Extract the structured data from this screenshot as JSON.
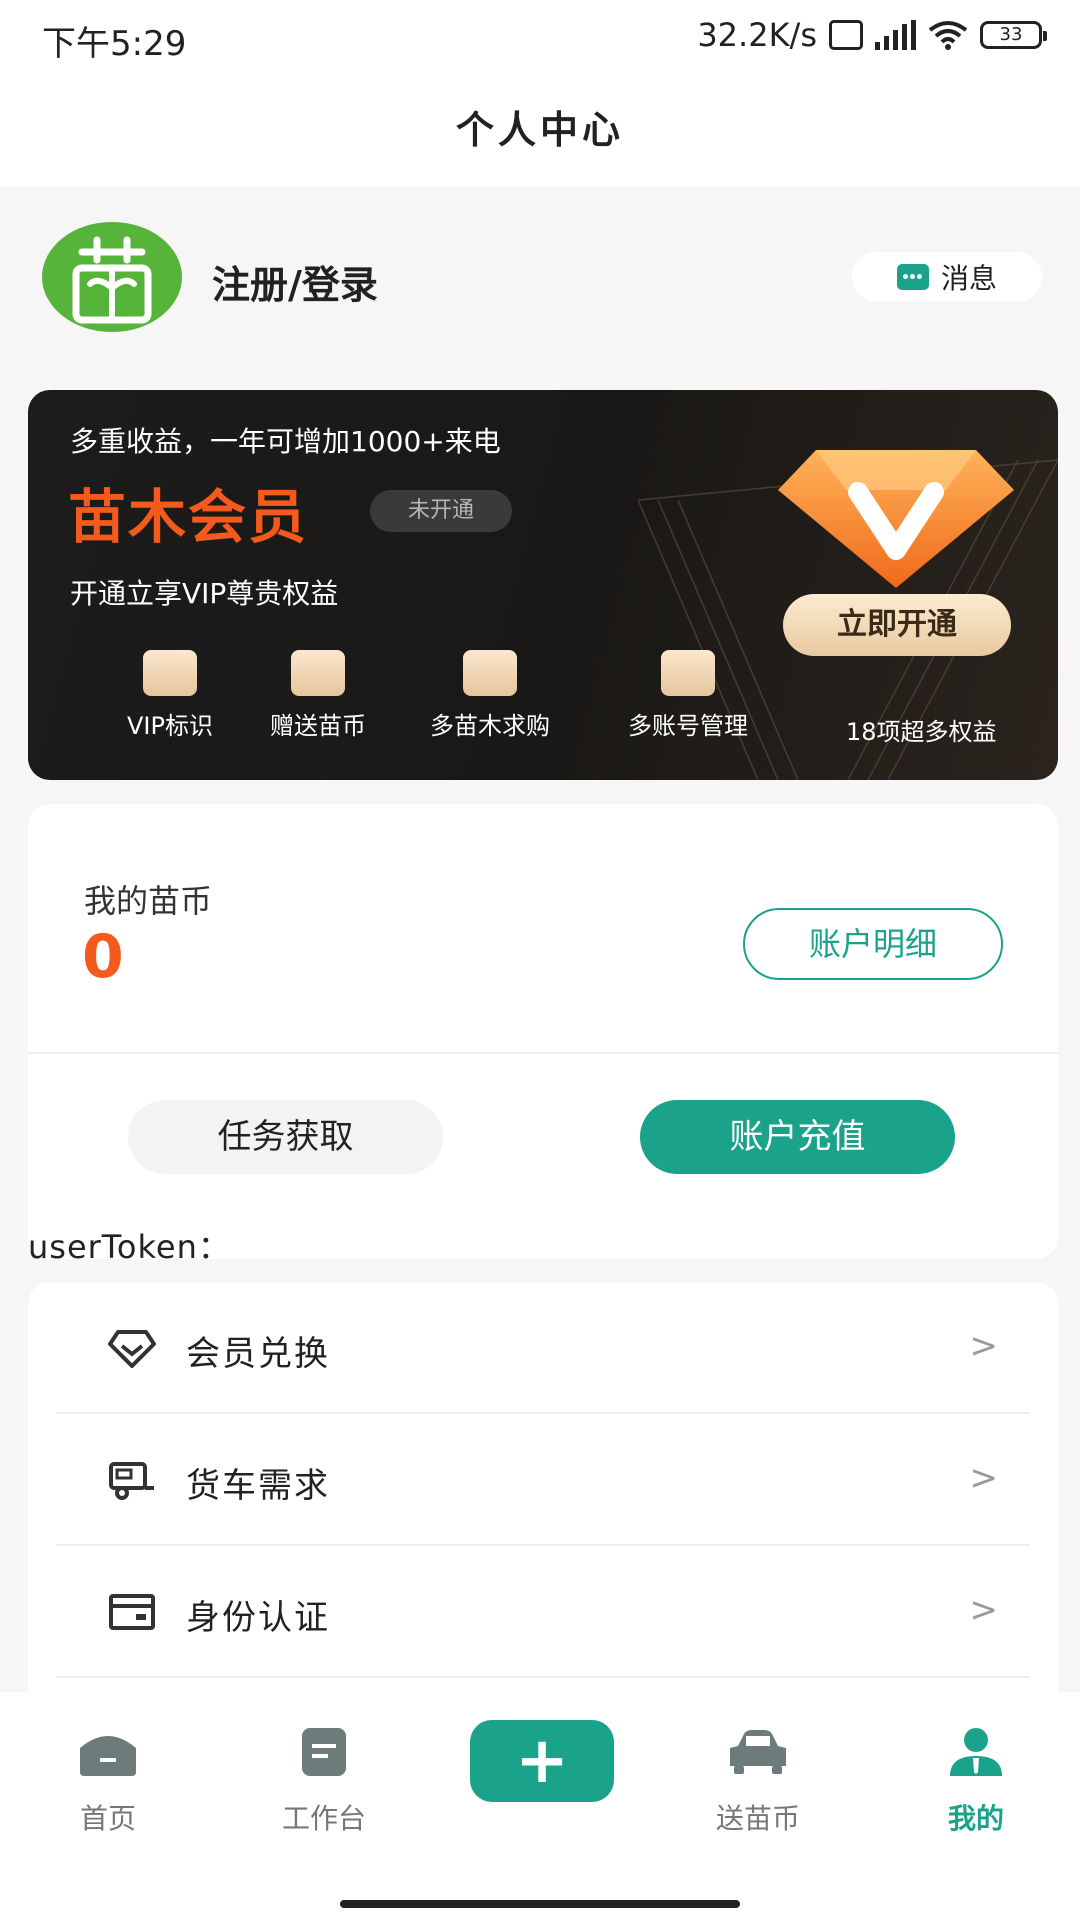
{
  "status_bar": {
    "time": "下午5:29",
    "net_speed": "32.2K/s",
    "battery": "33"
  },
  "header": {
    "title": "个人中心"
  },
  "profile": {
    "login_text": "注册/登录",
    "message_label": "消息"
  },
  "vip": {
    "subtitle": "多重收益，一年可增加1000+来电",
    "title": "苗木会员",
    "status_badge": "未开通",
    "description": "开通立享VIP尊贵权益",
    "open_button": "立即开通",
    "features": [
      "VIP标识",
      "赠送苗币",
      "多苗木求购",
      "多账号管理"
    ],
    "more": "18项超多权益"
  },
  "coins": {
    "label": "我的苗币",
    "value": "0",
    "detail_button": "账户明细",
    "task_button": "任务获取",
    "recharge_button": "账户充值"
  },
  "token_label": "userToken：",
  "menu": [
    {
      "label": "会员兑换",
      "icon": "diamond-icon"
    },
    {
      "label": "货车需求",
      "icon": "truck-icon"
    },
    {
      "label": "身份认证",
      "icon": "id-card-icon"
    }
  ],
  "bottom_nav": {
    "items": [
      {
        "label": "首页",
        "icon": "home-icon"
      },
      {
        "label": "工作台",
        "icon": "workbench-icon"
      },
      {
        "label": "送苗币",
        "icon": "car-icon"
      },
      {
        "label": "我的",
        "icon": "user-icon"
      }
    ],
    "active": "我的",
    "plus": "+"
  },
  "colors": {
    "accent": "#1aa38a",
    "orange": "#f45a1b",
    "avatar_green": "#57b43a"
  }
}
